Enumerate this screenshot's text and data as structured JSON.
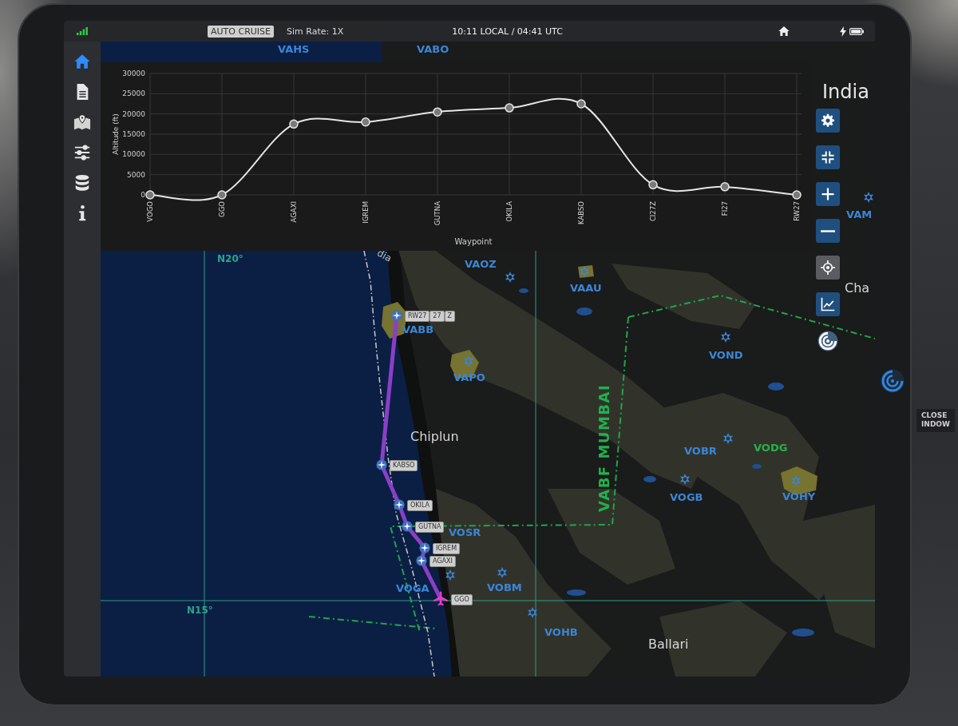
{
  "status_bar": {
    "mode_badge": "AUTO CRUISE",
    "sim_rate": "Sim Rate: 1X",
    "clock": "10:11 LOCAL / 04:41 UTC"
  },
  "sidebar": {
    "items": [
      {
        "selected": true
      },
      {
        "selected": false
      },
      {
        "selected": false
      },
      {
        "selected": false
      },
      {
        "selected": false
      },
      {
        "selected": false
      }
    ]
  },
  "altitude_profile": {
    "chart_data": {
      "type": "line",
      "xlabel": "Waypoint",
      "ylabel": "Altitude (ft)",
      "categories": [
        "VOGO",
        "GGO",
        "AGAXI",
        "IGREM",
        "GUTNA",
        "OKILA",
        "KABSO",
        "CI27Z",
        "FI27",
        "RW27"
      ],
      "series": [
        {
          "color": "#e6e6e6",
          "marker": "circle",
          "values": [
            0,
            0,
            17500,
            18000,
            20500,
            21500,
            22500,
            2500,
            2000,
            0
          ]
        }
      ],
      "ylim": [
        0,
        30000
      ],
      "yticks": [
        0,
        5000,
        10000,
        15000,
        20000,
        25000,
        30000
      ],
      "grid": true
    }
  },
  "map": {
    "labels": [
      {
        "kind": "airport",
        "text": "VAHS"
      },
      {
        "kind": "airport",
        "text": "VABO"
      },
      {
        "kind": "country",
        "text": "India"
      },
      {
        "kind": "airport",
        "text": "VAM"
      },
      {
        "kind": "latitude",
        "text": "N20°"
      },
      {
        "kind": "border",
        "text": "dia"
      },
      {
        "kind": "airport",
        "text": "VAOZ"
      },
      {
        "kind": "city",
        "text": "Cha"
      },
      {
        "kind": "airport",
        "text": "VAAU"
      },
      {
        "kind": "airport",
        "text": "VABB"
      },
      {
        "kind": "airport",
        "text": "VOND"
      },
      {
        "kind": "airport",
        "text": "VAPO"
      },
      {
        "kind": "city",
        "text": "Chiplun"
      },
      {
        "kind": "fir",
        "text": "VABF MUMBAI"
      },
      {
        "kind": "airfield",
        "text": "VODG"
      },
      {
        "kind": "airport",
        "text": "VOBR"
      },
      {
        "kind": "airport",
        "text": "VOGB"
      },
      {
        "kind": "airport",
        "text": "VOHY"
      },
      {
        "kind": "airport",
        "text": "VOSR"
      },
      {
        "kind": "airport",
        "text": "VOGA"
      },
      {
        "kind": "airport",
        "text": "VOBM"
      },
      {
        "kind": "latitude",
        "text": "N15°"
      },
      {
        "kind": "airport",
        "text": "VOHB"
      },
      {
        "kind": "city",
        "text": "Ballari"
      }
    ],
    "waypoints": [
      {
        "kind": "waypoint",
        "tags": [
          "RW27",
          "27",
          "Z"
        ]
      },
      {
        "kind": "waypoint",
        "tags": [
          "KABSO"
        ]
      },
      {
        "kind": "waypoint",
        "tags": [
          "OKILA"
        ]
      },
      {
        "kind": "waypoint",
        "tags": [
          "GUTNA"
        ]
      },
      {
        "kind": "waypoint",
        "tags": [
          "IGREM"
        ]
      },
      {
        "kind": "waypoint",
        "tags": [
          "AGAXI"
        ]
      },
      {
        "kind": "aircraft",
        "tags": [
          "GGO"
        ]
      }
    ]
  },
  "placard": [
    "CLOSE",
    "INDOW"
  ]
}
